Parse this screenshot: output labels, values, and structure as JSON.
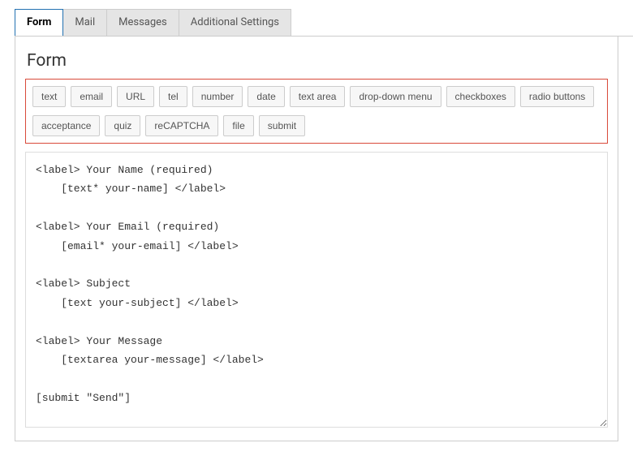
{
  "tabs": [
    {
      "label": "Form",
      "active": true
    },
    {
      "label": "Mail",
      "active": false
    },
    {
      "label": "Messages",
      "active": false
    },
    {
      "label": "Additional Settings",
      "active": false
    }
  ],
  "section_title": "Form",
  "tag_buttons": [
    "text",
    "email",
    "URL",
    "tel",
    "number",
    "date",
    "text area",
    "drop-down menu",
    "checkboxes",
    "radio buttons",
    "acceptance",
    "quiz",
    "reCAPTCHA",
    "file",
    "submit"
  ],
  "form_template": "<label> Your Name (required)\n    [text* your-name] </label>\n\n<label> Your Email (required)\n    [email* your-email] </label>\n\n<label> Subject\n    [text your-subject] </label>\n\n<label> Your Message\n    [textarea your-message] </label>\n\n[submit \"Send\"]"
}
